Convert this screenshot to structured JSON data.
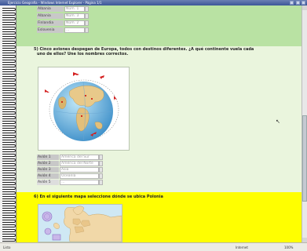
{
  "window": {
    "title": "Ejercicio Geografía - Windows Internet Explorer - Página 1/1"
  },
  "section_top": {
    "rows": [
      {
        "label": "Albania",
        "value": "Núm. 1"
      },
      {
        "label": "Albania",
        "value": "Núm. 3"
      },
      {
        "label": "Finlandia",
        "value": "Núm. 2"
      },
      {
        "label": "Eslovenia",
        "value": "..."
      }
    ]
  },
  "question5": {
    "text_line1": "5) Cinco aviones despegan de Europa, todos con destinos diferentes. ¿A qué continente vuela cada",
    "text_line2": "uno de ellos? Une los nombres correctos.",
    "rows": [
      {
        "label": "Avión 1",
        "value": "América del Sur"
      },
      {
        "label": "Avión 2",
        "value": "América del Norte"
      },
      {
        "label": "Avión 3",
        "value": "Asia"
      },
      {
        "label": "Avión 4",
        "value": "Oceanía"
      },
      {
        "label": "Avión 5",
        "value": "..."
      }
    ]
  },
  "question6": {
    "text": "6) En el siguiente mapa seleccione dónde se ubica Polonia"
  },
  "status": {
    "left": "Listo",
    "zone": "Internet",
    "zoom": "100%"
  }
}
